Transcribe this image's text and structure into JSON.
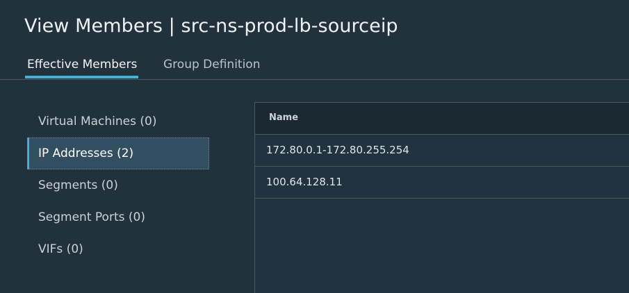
{
  "header": {
    "title": "View Members | src-ns-prod-lb-sourceip"
  },
  "tabs": [
    {
      "label": "Effective Members",
      "active": true
    },
    {
      "label": "Group Definition",
      "active": false
    }
  ],
  "sidebar": {
    "items": [
      {
        "label": "Virtual Machines (0)",
        "active": false
      },
      {
        "label": "IP Addresses (2)",
        "active": true
      },
      {
        "label": "Segments (0)",
        "active": false
      },
      {
        "label": "Segment Ports (0)",
        "active": false
      },
      {
        "label": "VIFs (0)",
        "active": false
      }
    ]
  },
  "table": {
    "columns": [
      "Name"
    ],
    "rows": [
      [
        "172.80.0.1-172.80.255.254"
      ],
      [
        "100.64.128.11"
      ]
    ]
  },
  "colors": {
    "background": "#22323c",
    "accent": "#49afd9",
    "active_item_bg": "#324f62"
  }
}
